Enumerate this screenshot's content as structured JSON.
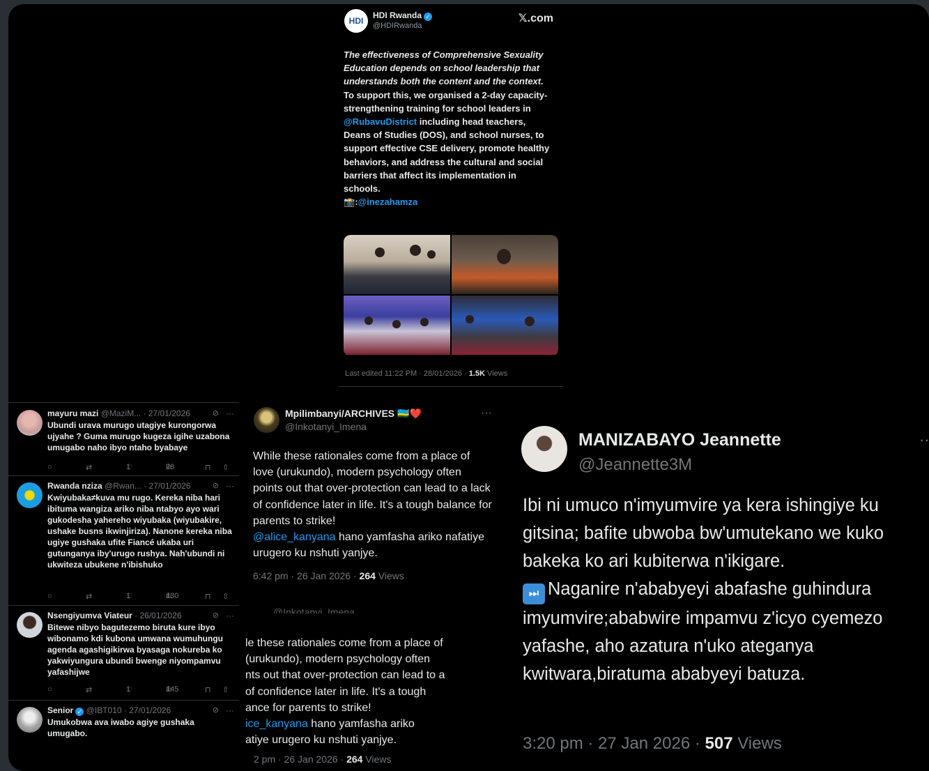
{
  "top_tweet": {
    "avatar_text": "HDI",
    "name": "HDI Rwanda",
    "handle": "@HDIRwanda",
    "site": "𝕏.com",
    "text_italic": "The effectiveness of Comprehensive Sexuality Education depends on school leadership that understands both the content and the context.",
    "text_p1": "To support this, we organised a 2-day capacity-strengthening training for school leaders in ",
    "mention1": "@RubavuDistrict",
    "text_p2": " including head teachers, Deans of Studies (DOS), and school nurses, to support effective CSE delivery, promote healthy behaviors, and address the cultural and social barriers that affect its implementation in schools.",
    "camera_emoji": "📸",
    "credit_prefix": ":",
    "mention2": "@inezahamza",
    "meta_prefix": "Last edited 11:22 PM · 28/01/2026 · ",
    "views_count": "1.5K",
    "views_label": " Views"
  },
  "replies": [
    {
      "name": "mayuru mazi",
      "meta": " @MaziM... · 27/01/2026",
      "text": "Ubundi urava murugo utagiye kurongorwa ujyahe ? Guma murugo kugeza igihe uzabona umugabo naho ibyo ntaho byabaye",
      "likes": "1",
      "views": "28"
    },
    {
      "name": "Rwanda nziza",
      "meta": " @Rwan... · 27/01/2026",
      "text": "Kwiyubaka≠kuva mu rugo. Kereka niba hari ibituma wangiza ariko niba ntabyo ayo wari gukodesha yahereho wiyubaka (wiyubakire, ushake busns ikwinjiriza). Nanone kereka niba ugiye gushaka ufite Fiancé ukaba uri gutunganya iby'urugo rushya. Nah'ubundi ni ukwiteza ubukene n'ibishuko",
      "likes": "1",
      "views": "130"
    },
    {
      "name": "Nsengiyumva Viateur",
      "meta": " · 26/01/2026",
      "text": "Bitewe nibyo bagutezemo biruta kure ibyo wibonamo kdi kubona umwana wumuhungu agenda agashigikirwa byasaga nokureba ko yakwiyungura ubundi bwenge niyompamvu yafashijwe",
      "likes": "1",
      "views": "145"
    },
    {
      "name": "Senior",
      "meta": " @IBT010 · 27/01/2026",
      "text": "Umukobwa ava iwabo agiye gushaka umugabo."
    }
  ],
  "mid_tweet": {
    "name": "Mpilimbanyi/ARCHIVES",
    "flag_emoji": "🇷🇼❤️",
    "handle": "@Inkotanyi_Imena",
    "text_a": "While these rationales come from a place of love (urukundo), modern psychology often points out that over-protection can lead to a lack of confidence later in life. It's a tough balance for parents to strike!",
    "mention": "@alice_kanyana",
    "text_b": " hano yamfasha ariko nafatiye urugero ku nshuti yanjye.",
    "time": "6:42 pm · 26 Jan 2026 · ",
    "views_count": "264",
    "views_label": " Views"
  },
  "mid_crop": {
    "handle_fragment": "@Inkotanyi_Imena",
    "line1": "le these rationales come from a place of",
    "line2": "(urukundo), modern psychology often",
    "line3": "nts out that over-protection can lead to a",
    "line4": "of confidence later in life. It's a tough",
    "line5": "ance for parents to strike!",
    "mention": "ice_kanyana",
    "line6_rest": " hano yamfasha ariko",
    "line7": "atiye urugero ku nshuti yanjye.",
    "time": "2 pm · 26 Jan 2026 · ",
    "views_count": "264",
    "views_label": " Views"
  },
  "right_tweet": {
    "name": "MANIZABAYO Jeannette",
    "handle": "@Jeannette3M",
    "text_a": "Ibi ni umuco n'imyumvire ya kera ishingiye ku gitsina; bafite ubwoba bw'umutekano we kuko bakeka ko ari  kubiterwa n'ikigare.",
    "ffwd_glyph": "⏭",
    "text_b": "Naganire n'ababyeyi abafashe guhindura imyumvire;ababwire impamvu z'icyo cyemezo yafashe, aho azatura n'uko ateganya kwitwara,biratuma ababyeyi batuza.",
    "time": "3:20 pm · 27 Jan 2026 · ",
    "views_count": "507",
    "views_label": " Views"
  },
  "icons": {
    "reply": "○",
    "retweet": "⇄",
    "like": "♡",
    "views": "ılı",
    "bookmark": "⊓",
    "share": "⇧",
    "more": "···",
    "grok": "⊘",
    "check": "✓"
  },
  "colors": {
    "link": "#1d9bf0",
    "muted": "#71767b",
    "background": "#000000",
    "frame": "#2a2f36"
  }
}
